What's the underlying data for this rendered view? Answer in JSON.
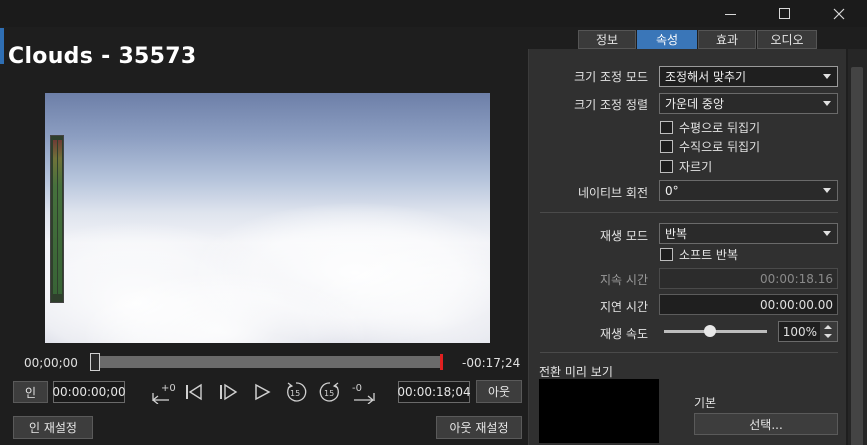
{
  "window": {
    "minimize_icon": "minimize-icon",
    "maximize_icon": "maximize-icon",
    "close_icon": "close-icon"
  },
  "clip": {
    "title": "Clouds - 35573"
  },
  "player": {
    "current_time": "00;00;00",
    "remaining_time": "-00:17;24",
    "in_button": "인",
    "in_timecode": "00:00:00;00",
    "out_timecode": "00:00:18;04",
    "out_button": "아웃",
    "reset_in_button": "인 재설정",
    "reset_out_button": "아웃 재설정",
    "skip_back_label": "+0",
    "skip_forward_label": "-0",
    "rewind_15_label": "15",
    "forward_15_label": "15",
    "scrub_position": 0.0
  },
  "tabs": [
    {
      "label": "정보"
    },
    {
      "label": "속성"
    },
    {
      "label": "효과"
    },
    {
      "label": "오디오"
    }
  ],
  "active_tab": "속성",
  "properties": {
    "scale_mode_label": "크기 조정 모드",
    "scale_mode_value": "조정해서 맞추기",
    "scale_align_label": "크기 조정 정렬",
    "scale_align_value": "가운데 중앙",
    "flip_h_label": "수평으로 뒤집기",
    "flip_v_label": "수직으로 뒤집기",
    "crop_label": "자르기",
    "native_rotation_label": "네이티브 회전",
    "native_rotation_value": "0°",
    "playback_mode_label": "재생 모드",
    "playback_mode_value": "반복",
    "soft_loop_label": "소프트 반복",
    "duration_label": "지속 시간",
    "duration_value": "00:00:18.16",
    "delay_label": "지연 시간",
    "delay_value": "00:00:00.00",
    "speed_label": "재생 속도",
    "speed_value": "100%",
    "speed_fraction": 0.45,
    "transition_preview_label": "전환 미리 보기",
    "transition_name": "기본",
    "select_button": "선택..."
  },
  "colors": {
    "accent": "#3a76b8",
    "out_marker": "#e02020",
    "panel_bg": "#303030"
  }
}
